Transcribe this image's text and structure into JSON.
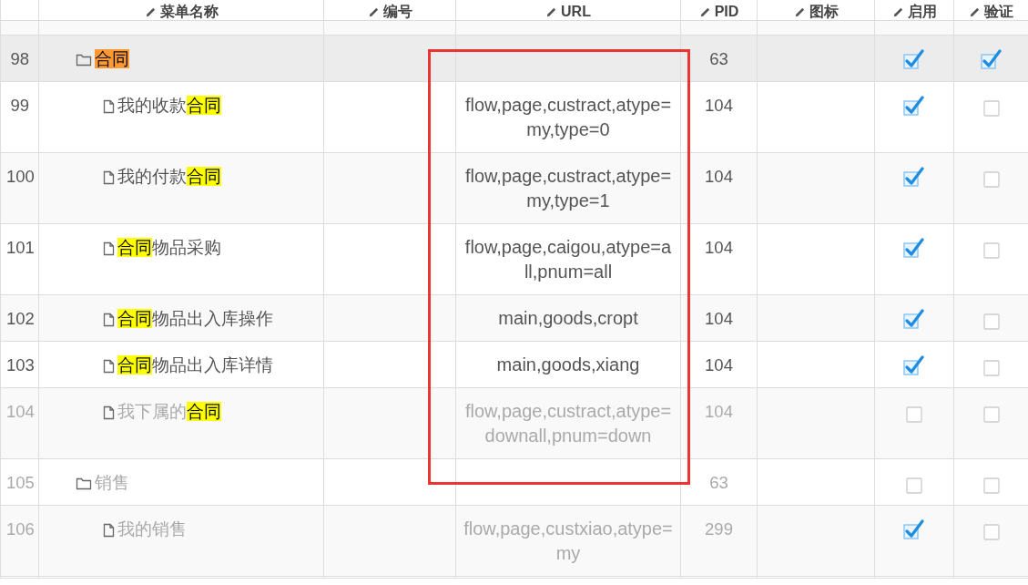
{
  "table": {
    "columns": [
      "菜单名称",
      "编号",
      "URL",
      "PID",
      "图标",
      "启用",
      "验证"
    ],
    "rows": [
      {
        "id": "98",
        "kind": "folder",
        "name_parts": [
          {
            "text": "合同",
            "color": "#ff9933"
          }
        ],
        "number": "",
        "url": "",
        "pid": "63",
        "greyed": false,
        "enabled": true,
        "verify": true,
        "selected": true,
        "children": [
          {
            "id": "99",
            "kind": "file",
            "name_parts": [
              {
                "text": "我的收款"
              },
              {
                "text": "合同",
                "color": "#ffff00"
              }
            ],
            "url": "flow,page,custract,atype=my,type=0",
            "pid": "104",
            "greyed": false,
            "enabled": true,
            "verify": false,
            "selected": false
          },
          {
            "id": "100",
            "kind": "file",
            "name_parts": [
              {
                "text": "我的付款"
              },
              {
                "text": "合同",
                "color": "#ffff00"
              }
            ],
            "url": "flow,page,custract,atype=my,type=1",
            "pid": "104",
            "greyed": false,
            "enabled": true,
            "verify": false,
            "selected": false
          },
          {
            "id": "101",
            "kind": "file",
            "name_parts": [
              {
                "text": "合同",
                "color": "#ffff00"
              },
              {
                "text": "物品采购"
              }
            ],
            "url": "flow,page,caigou,atype=all,pnum=all",
            "pid": "104",
            "greyed": false,
            "enabled": true,
            "verify": false,
            "selected": false
          },
          {
            "id": "102",
            "kind": "file",
            "name_parts": [
              {
                "text": "合同",
                "color": "#ffff00"
              },
              {
                "text": "物品出入库操作"
              }
            ],
            "url": "main,goods,cropt",
            "pid": "104",
            "greyed": false,
            "enabled": true,
            "verify": false,
            "selected": false
          },
          {
            "id": "103",
            "kind": "file",
            "name_parts": [
              {
                "text": "合同",
                "color": "#ffff00"
              },
              {
                "text": "物品出入库详情"
              }
            ],
            "url": "main,goods,xiang",
            "pid": "104",
            "greyed": false,
            "enabled": true,
            "verify": false,
            "selected": false
          },
          {
            "id": "104",
            "kind": "file",
            "name_parts": [
              {
                "text": "我下属的"
              },
              {
                "text": "合同",
                "color": "#ffff00"
              }
            ],
            "url": "flow,page,custract,atype=downall,pnum=down",
            "pid": "104",
            "greyed": true,
            "enabled": false,
            "verify": false,
            "selected": false
          }
        ]
      },
      {
        "id": "105",
        "kind": "folder",
        "name_parts": [
          {
            "text": "销售"
          }
        ],
        "url": "",
        "pid": "63",
        "greyed": true,
        "enabled": false,
        "verify": false,
        "selected": false,
        "children": [
          {
            "id": "106",
            "kind": "file",
            "name_parts": [
              {
                "text": "我的销售"
              }
            ],
            "url": "flow,page,custxiao,atype=my",
            "pid": "299",
            "greyed": true,
            "enabled": true,
            "verify": false,
            "selected": false
          }
        ]
      }
    ]
  },
  "annotation": {
    "kind": "rectangle",
    "color": "#ee3333"
  }
}
